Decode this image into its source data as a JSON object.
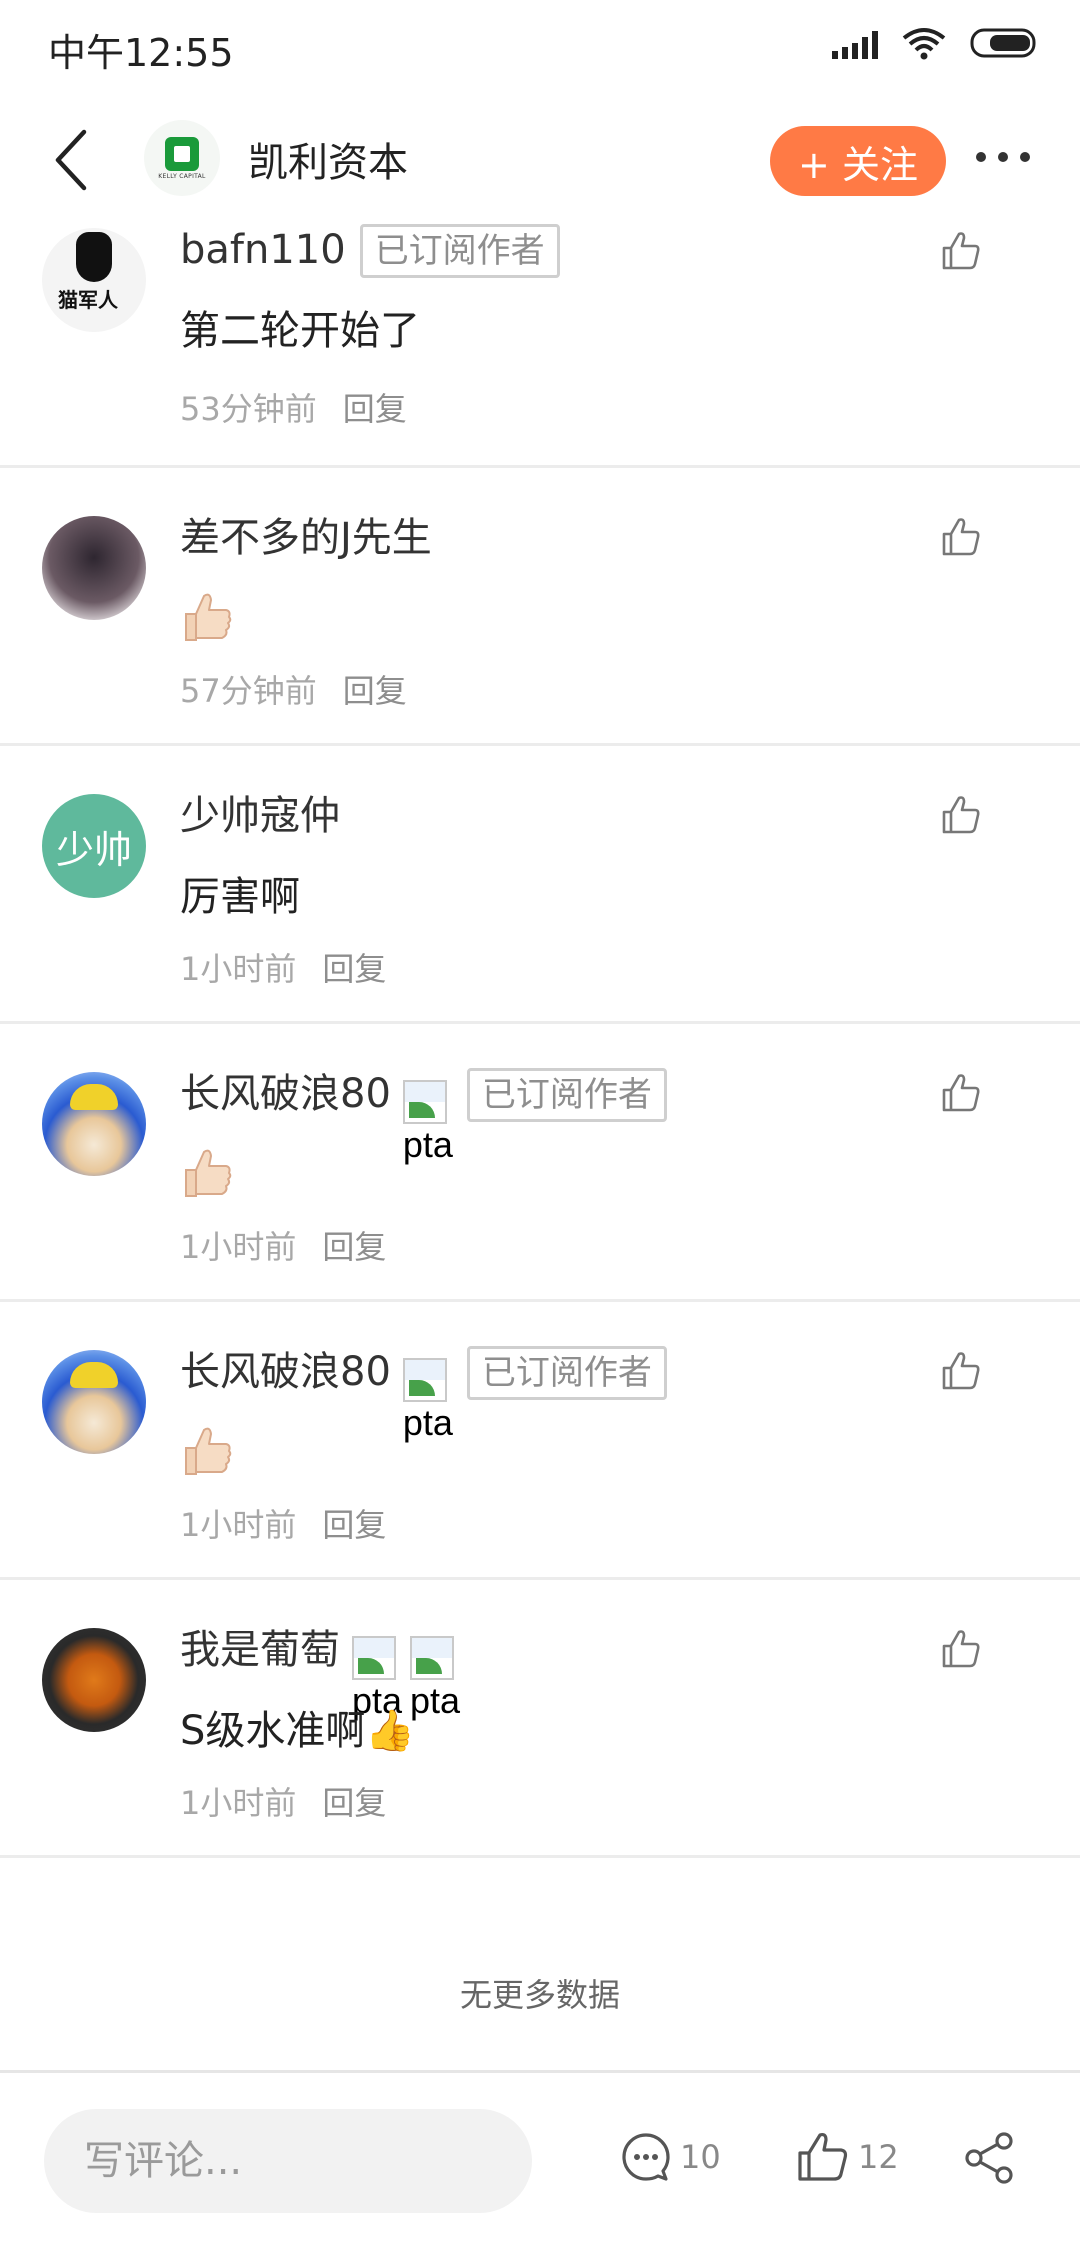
{
  "status_bar": {
    "time": "中午12:55"
  },
  "header": {
    "title": "凯利资本",
    "logo_caption": "KELLY CAPITAL",
    "follow_label": "+ 关注"
  },
  "comments": [
    {
      "name": "bafn110",
      "tag": "已订阅作者",
      "text": "第二轮开始了",
      "time": "53分钟前",
      "reply": "回复"
    },
    {
      "name": "差不多的J先生",
      "emoji": "thumbs-up",
      "time": "57分钟前",
      "reply": "回复"
    },
    {
      "name": "少帅寇仲",
      "avatar_text": "少帅",
      "text": "厉害啊",
      "time": "1小时前",
      "reply": "回复"
    },
    {
      "name": "长风破浪80",
      "badge_alt": "pta",
      "tag": "已订阅作者",
      "emoji": "thumbs-up",
      "time": "1小时前",
      "reply": "回复"
    },
    {
      "name": "长风破浪80",
      "badge_alt": "pta",
      "tag": "已订阅作者",
      "emoji": "thumbs-up",
      "time": "1小时前",
      "reply": "回复"
    },
    {
      "name": "我是葡萄",
      "badge_alt": "pta",
      "badge_alt_2": "pta",
      "text": "S级水准啊👍",
      "time": "1小时前",
      "reply": "回复"
    }
  ],
  "footer": {
    "no_more": "无更多数据"
  },
  "bottom_bar": {
    "input_placeholder": "写评论...",
    "comment_count": "10",
    "like_count": "12"
  },
  "colors": {
    "accent": "#ff7a45",
    "avatar_green": "#5fb99c"
  }
}
